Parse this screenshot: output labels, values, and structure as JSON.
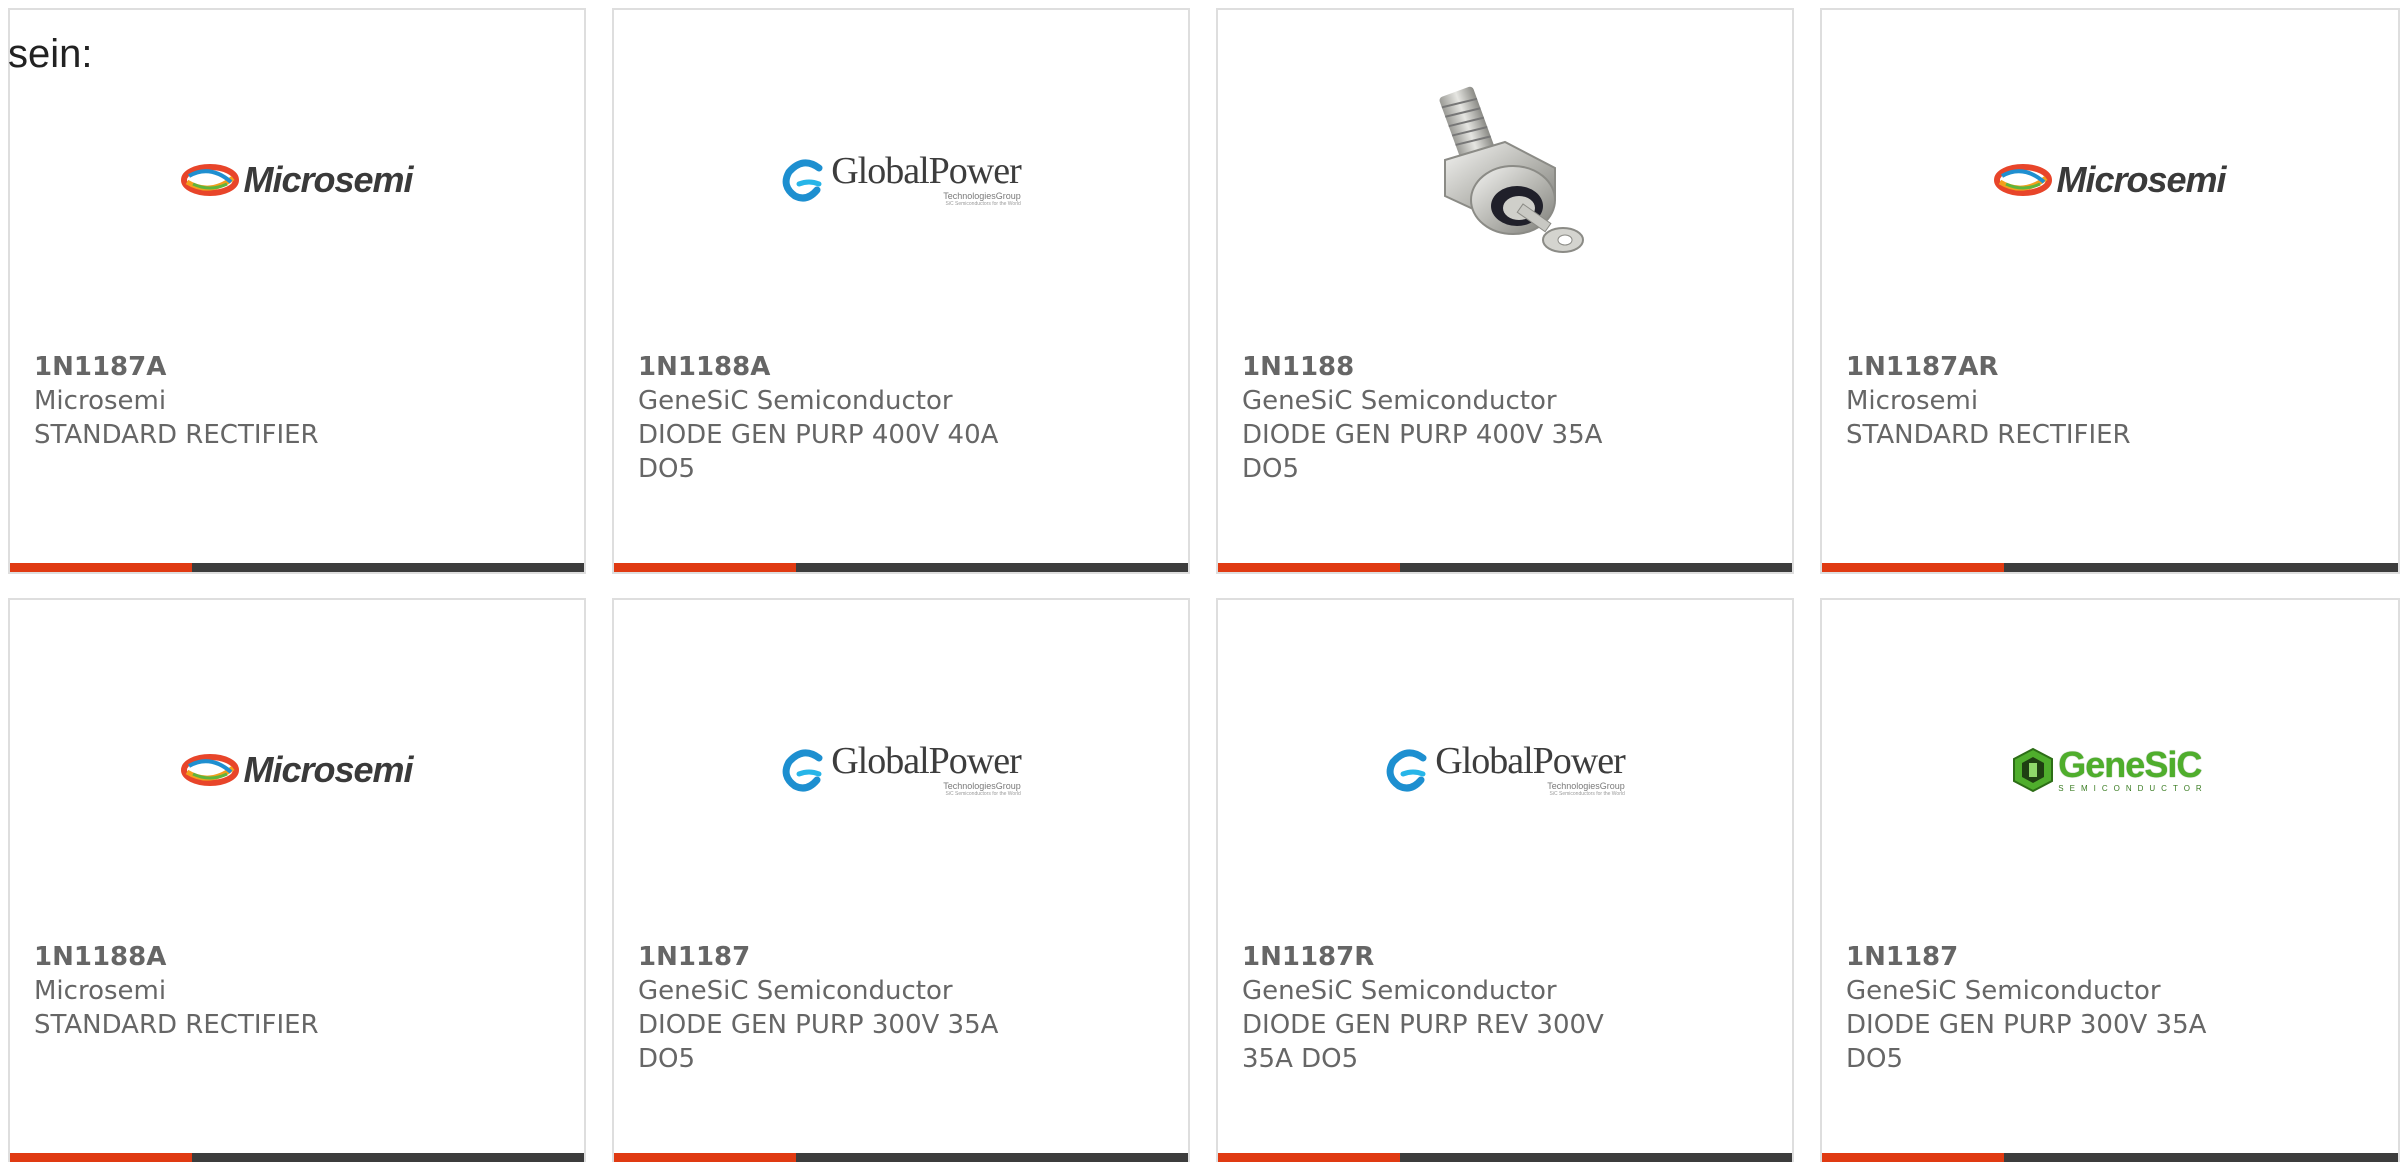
{
  "intro_text": "sein:",
  "colors": {
    "accent": "#e03a12",
    "bar": "#3c3c3c",
    "card_border": "#dedede",
    "text": "#666666"
  },
  "logos": {
    "microsemi": {
      "text": "Microsemi",
      "icon": "microsemi-swirl-icon"
    },
    "globalpower": {
      "text": "GlobalPower",
      "sub": "TechnologiesGroup",
      "tagline": "SiC Semiconductors for the World",
      "icon": "globalpower-swoosh-icon"
    },
    "genesic": {
      "text": "GeneSiC",
      "sub": "SEMICONDUCTOR",
      "icon": "genesic-hexagon-icon"
    },
    "product_photo": {
      "icon": "stud-diode-photo"
    }
  },
  "products": [
    {
      "part_number": "1N1187A",
      "manufacturer": "Microsemi",
      "description": "STANDARD RECTIFIER",
      "logo": "microsemi"
    },
    {
      "part_number": "1N1188A",
      "manufacturer": "GeneSiC Semiconductor",
      "description": "DIODE GEN PURP 400V 40A DO5",
      "logo": "globalpower"
    },
    {
      "part_number": "1N1188",
      "manufacturer": "GeneSiC Semiconductor",
      "description": "DIODE GEN PURP 400V 35A DO5",
      "logo": "product_photo"
    },
    {
      "part_number": "1N1187AR",
      "manufacturer": "Microsemi",
      "description": "STANDARD RECTIFIER",
      "logo": "microsemi"
    },
    {
      "part_number": "1N1188A",
      "manufacturer": "Microsemi",
      "description": "STANDARD RECTIFIER",
      "logo": "microsemi"
    },
    {
      "part_number": "1N1187",
      "manufacturer": "GeneSiC Semiconductor",
      "description": "DIODE GEN PURP 300V 35A DO5",
      "logo": "globalpower"
    },
    {
      "part_number": "1N1187R",
      "manufacturer": "GeneSiC Semiconductor",
      "description": "DIODE GEN PURP REV 300V 35A DO5",
      "logo": "globalpower"
    },
    {
      "part_number": "1N1187",
      "manufacturer": "GeneSiC Semiconductor",
      "description": "DIODE GEN PURP 300V 35A DO5",
      "logo": "genesic"
    }
  ]
}
